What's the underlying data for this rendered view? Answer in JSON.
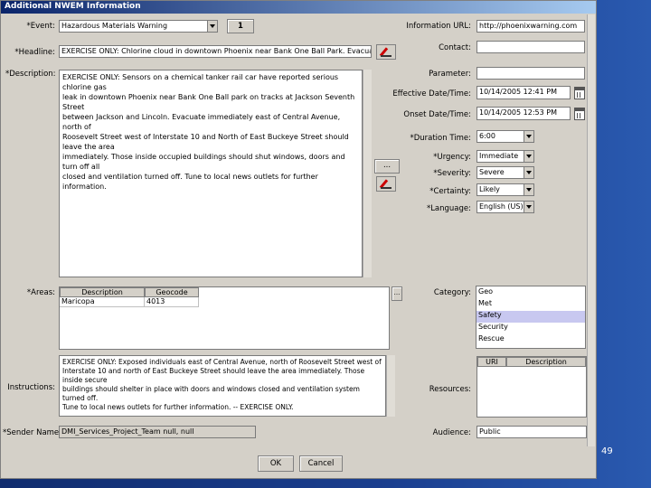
{
  "window": {
    "title": "Additional NWEM Information"
  },
  "labels": {
    "event": "*Event:",
    "headline": "*Headline:",
    "description": "*Description:",
    "areas": "*Areas:",
    "instructions": "Instructions:",
    "sender_name": "*Sender Name:",
    "information_url": "Information URL:",
    "contact": "Contact:",
    "parameter": "Parameter:",
    "effective": "Effective Date/Time:",
    "onset": "Onset Date/Time:",
    "duration": "*Duration Time:",
    "urgency": "*Urgency:",
    "severity": "*Severity:",
    "certainty": "*Certainty:",
    "language": "*Language:",
    "category": "Category:",
    "resources": "Resources:",
    "audience": "Audience:"
  },
  "fields": {
    "event": "Hazardous Materials Warning",
    "event_button": "1",
    "headline": "EXERCISE ONLY: Chlorine cloud in downtown Phoenix near Bank One Ball Park. Evacuate imm",
    "description": "EXERCISE ONLY: Sensors on a chemical tanker rail car have reported serious chlorine gas\nleak in downtown Phoenix near Bank One Ball park on tracks at Jackson Seventh Street\nbetween Jackson and Lincoln. Evacuate immediately east of Central Avenue, north of\nRoosevelt Street west of Interstate 10 and North of East Buckeye Street should leave the area\nimmediately. Those inside occupied buildings should shut windows, doors and turn off all\nclosed and ventilation turned off. Tune to local news outlets for further information.",
    "information_url": "http://phoenixwarning.com",
    "contact": "",
    "parameter": "",
    "effective": "10/14/2005 12:41 PM",
    "onset": "10/14/2005 12:53 PM",
    "duration": "6:00",
    "urgency": "Immediate",
    "severity": "Severe",
    "certainty": "Likely",
    "language": "English (US)",
    "sender_name": "DMI_Services_Project_Team null, null",
    "audience": "Public",
    "instructions": "EXERCISE ONLY: Exposed individuals east of Central Avenue, north of Roosevelt Street west of\nInterstate 10 and north of East Buckeye Street should leave the area immediately. Those inside secure\nbuildings should shelter in place with doors and windows closed and ventilation system turned off.\nTune to local news outlets for further information. -- EXERCISE ONLY."
  },
  "areas_table": {
    "headers": [
      "Description",
      "Geocode"
    ],
    "rows": [
      [
        "Maricopa",
        "4013"
      ]
    ]
  },
  "category_options": [
    {
      "label": "Geo",
      "selected": false
    },
    {
      "label": "Met",
      "selected": false
    },
    {
      "label": "Safety",
      "selected": true
    },
    {
      "label": "Security",
      "selected": false
    },
    {
      "label": "Rescue",
      "selected": false
    }
  ],
  "resources_table": {
    "headers": [
      "URI",
      "Description"
    ]
  },
  "buttons": {
    "ellipsis": "...",
    "ok": "OK",
    "cancel": "Cancel"
  },
  "slide": {
    "number": "49"
  },
  "colors": {
    "title_bar": "#0a246a",
    "dialog": "#d4d0c8",
    "selection": "#c8c8f0",
    "background": "#102c6e"
  }
}
